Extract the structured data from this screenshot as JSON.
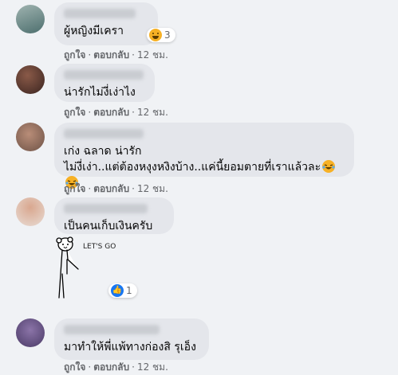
{
  "comments": [
    {
      "text": "ผู้หญิงมีเครา",
      "reaction_count": "3",
      "actions": {
        "like": "ถูกใจ",
        "reply": "ตอบกลับ",
        "time": "12 ชม."
      }
    },
    {
      "text": "น่ารักไม่งี่เง่าไง",
      "actions": {
        "like": "ถูกใจ",
        "reply": "ตอบกลับ",
        "time": "12 ชม."
      }
    },
    {
      "text_line1": "เก่ง ฉลาด น่ารัก",
      "text_line2": "ไม่งี่เง่า..แต่ต้องหงุงหงิงบ้าง..แค่นี้ยอมตายที่เราแล้วละ",
      "actions": {
        "like": "ถูกใจ",
        "reply": "ตอบกลับ",
        "time": "12 ชม."
      }
    },
    {
      "text": "เป็นคนเก็บเงินครับ",
      "sticker_text": "LET'S GO",
      "reaction_count": "1"
    },
    {
      "text": "มาทำให้พี่แพ้ทางก่องสิ รุเอ็ง",
      "actions": {
        "like": "ถูกใจ",
        "reply": "ตอบกลับ",
        "time": "12 ชม."
      }
    }
  ],
  "separator": "·",
  "colors": {
    "background": "#f0f2f5",
    "bubble": "#e4e6eb",
    "meta_text": "#65676b",
    "like_blue": "#1877f2",
    "haha_yellow": "#f7b125"
  },
  "icons": {
    "haha": "laughing-face-emoji",
    "like": "thumbs-up-icon"
  }
}
